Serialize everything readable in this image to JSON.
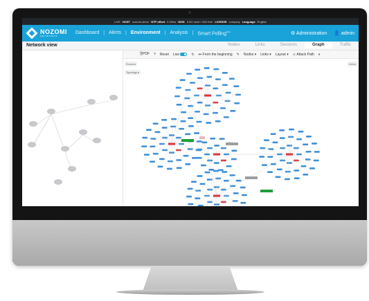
{
  "statusbar": {
    "live": "LIVE",
    "host_label": "HOST",
    "host_value": "nozomi-demo",
    "ntp_label": "NTP offset",
    "ntp_value": "0.05ms",
    "disk_label": "DISK",
    "disk_value": "5.5G used / 20G free",
    "license_label": "LICENSE",
    "license_value": "company",
    "language_label": "Language",
    "language_value": "English"
  },
  "topbar": {
    "logo_text": "NOZOMI",
    "logo_sub": "NETWORKS",
    "nav": [
      "Dashboard",
      "Alerts",
      "Environment",
      "Analysis",
      "Smart Polling"
    ],
    "nav_sup": "beta",
    "active_nav": "Environment",
    "admin": "Administration",
    "user": "admin"
  },
  "page": {
    "title": "Network view",
    "tabs": [
      "Nodes",
      "Links",
      "Sessions",
      "Graph",
      "Traffic"
    ],
    "active_tab": "Graph"
  },
  "toolbar": {
    "pdf": "PDF",
    "help": "?",
    "reset": "Reset",
    "live": "Live",
    "from_beginning": "From the beginning",
    "nodes": "Nodes",
    "links": "Links",
    "layout": "Layout",
    "attack_path": "Attack Path"
  },
  "graph": {
    "zones_chip": "Zones",
    "topology_chip": "Topology",
    "info_chip": "Info"
  },
  "colors": {
    "accent": "#1aa3d9",
    "node_blue": "#3f8fd6",
    "red": "#d9363e",
    "green": "#1e9e3a",
    "grey": "#9e9e9e"
  },
  "icons": {
    "camera": "webcam-dot",
    "logo": "nozomi-diamond",
    "admin": "gear-icon",
    "user": "user-icon",
    "pause": "pause-icon",
    "refresh": "refresh-icon",
    "edit": "pencil-icon",
    "attack": "attack-path-icon",
    "cloud": "cloud-icon"
  }
}
